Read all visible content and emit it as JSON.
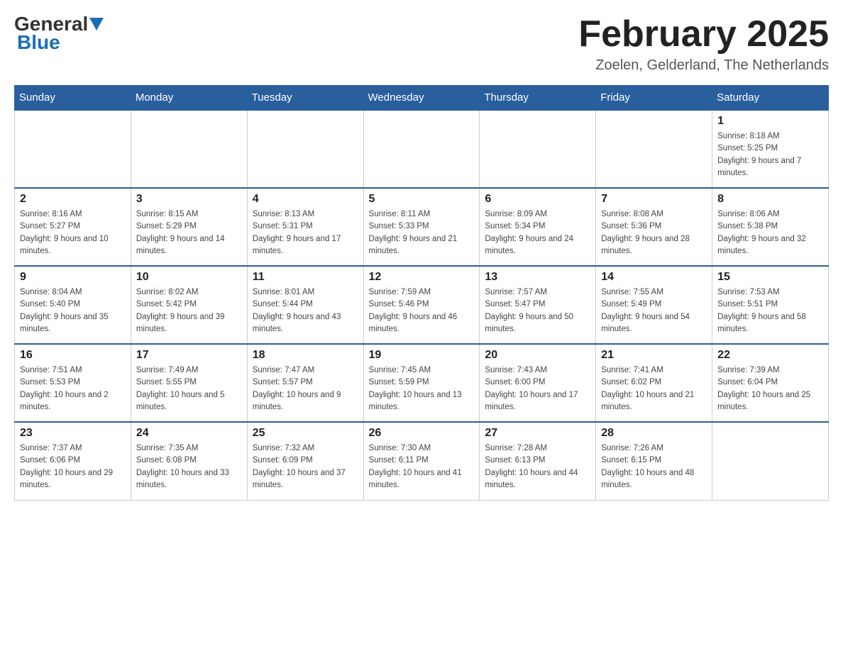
{
  "header": {
    "logo_general": "General",
    "logo_blue": "Blue",
    "month_title": "February 2025",
    "location": "Zoelen, Gelderland, The Netherlands"
  },
  "weekdays": [
    "Sunday",
    "Monday",
    "Tuesday",
    "Wednesday",
    "Thursday",
    "Friday",
    "Saturday"
  ],
  "weeks": [
    [
      {
        "day": "",
        "info": ""
      },
      {
        "day": "",
        "info": ""
      },
      {
        "day": "",
        "info": ""
      },
      {
        "day": "",
        "info": ""
      },
      {
        "day": "",
        "info": ""
      },
      {
        "day": "",
        "info": ""
      },
      {
        "day": "1",
        "info": "Sunrise: 8:18 AM\nSunset: 5:25 PM\nDaylight: 9 hours and 7 minutes."
      }
    ],
    [
      {
        "day": "2",
        "info": "Sunrise: 8:16 AM\nSunset: 5:27 PM\nDaylight: 9 hours and 10 minutes."
      },
      {
        "day": "3",
        "info": "Sunrise: 8:15 AM\nSunset: 5:29 PM\nDaylight: 9 hours and 14 minutes."
      },
      {
        "day": "4",
        "info": "Sunrise: 8:13 AM\nSunset: 5:31 PM\nDaylight: 9 hours and 17 minutes."
      },
      {
        "day": "5",
        "info": "Sunrise: 8:11 AM\nSunset: 5:33 PM\nDaylight: 9 hours and 21 minutes."
      },
      {
        "day": "6",
        "info": "Sunrise: 8:09 AM\nSunset: 5:34 PM\nDaylight: 9 hours and 24 minutes."
      },
      {
        "day": "7",
        "info": "Sunrise: 8:08 AM\nSunset: 5:36 PM\nDaylight: 9 hours and 28 minutes."
      },
      {
        "day": "8",
        "info": "Sunrise: 8:06 AM\nSunset: 5:38 PM\nDaylight: 9 hours and 32 minutes."
      }
    ],
    [
      {
        "day": "9",
        "info": "Sunrise: 8:04 AM\nSunset: 5:40 PM\nDaylight: 9 hours and 35 minutes."
      },
      {
        "day": "10",
        "info": "Sunrise: 8:02 AM\nSunset: 5:42 PM\nDaylight: 9 hours and 39 minutes."
      },
      {
        "day": "11",
        "info": "Sunrise: 8:01 AM\nSunset: 5:44 PM\nDaylight: 9 hours and 43 minutes."
      },
      {
        "day": "12",
        "info": "Sunrise: 7:59 AM\nSunset: 5:46 PM\nDaylight: 9 hours and 46 minutes."
      },
      {
        "day": "13",
        "info": "Sunrise: 7:57 AM\nSunset: 5:47 PM\nDaylight: 9 hours and 50 minutes."
      },
      {
        "day": "14",
        "info": "Sunrise: 7:55 AM\nSunset: 5:49 PM\nDaylight: 9 hours and 54 minutes."
      },
      {
        "day": "15",
        "info": "Sunrise: 7:53 AM\nSunset: 5:51 PM\nDaylight: 9 hours and 58 minutes."
      }
    ],
    [
      {
        "day": "16",
        "info": "Sunrise: 7:51 AM\nSunset: 5:53 PM\nDaylight: 10 hours and 2 minutes."
      },
      {
        "day": "17",
        "info": "Sunrise: 7:49 AM\nSunset: 5:55 PM\nDaylight: 10 hours and 5 minutes."
      },
      {
        "day": "18",
        "info": "Sunrise: 7:47 AM\nSunset: 5:57 PM\nDaylight: 10 hours and 9 minutes."
      },
      {
        "day": "19",
        "info": "Sunrise: 7:45 AM\nSunset: 5:59 PM\nDaylight: 10 hours and 13 minutes."
      },
      {
        "day": "20",
        "info": "Sunrise: 7:43 AM\nSunset: 6:00 PM\nDaylight: 10 hours and 17 minutes."
      },
      {
        "day": "21",
        "info": "Sunrise: 7:41 AM\nSunset: 6:02 PM\nDaylight: 10 hours and 21 minutes."
      },
      {
        "day": "22",
        "info": "Sunrise: 7:39 AM\nSunset: 6:04 PM\nDaylight: 10 hours and 25 minutes."
      }
    ],
    [
      {
        "day": "23",
        "info": "Sunrise: 7:37 AM\nSunset: 6:06 PM\nDaylight: 10 hours and 29 minutes."
      },
      {
        "day": "24",
        "info": "Sunrise: 7:35 AM\nSunset: 6:08 PM\nDaylight: 10 hours and 33 minutes."
      },
      {
        "day": "25",
        "info": "Sunrise: 7:32 AM\nSunset: 6:09 PM\nDaylight: 10 hours and 37 minutes."
      },
      {
        "day": "26",
        "info": "Sunrise: 7:30 AM\nSunset: 6:11 PM\nDaylight: 10 hours and 41 minutes."
      },
      {
        "day": "27",
        "info": "Sunrise: 7:28 AM\nSunset: 6:13 PM\nDaylight: 10 hours and 44 minutes."
      },
      {
        "day": "28",
        "info": "Sunrise: 7:26 AM\nSunset: 6:15 PM\nDaylight: 10 hours and 48 minutes."
      },
      {
        "day": "",
        "info": ""
      }
    ]
  ]
}
